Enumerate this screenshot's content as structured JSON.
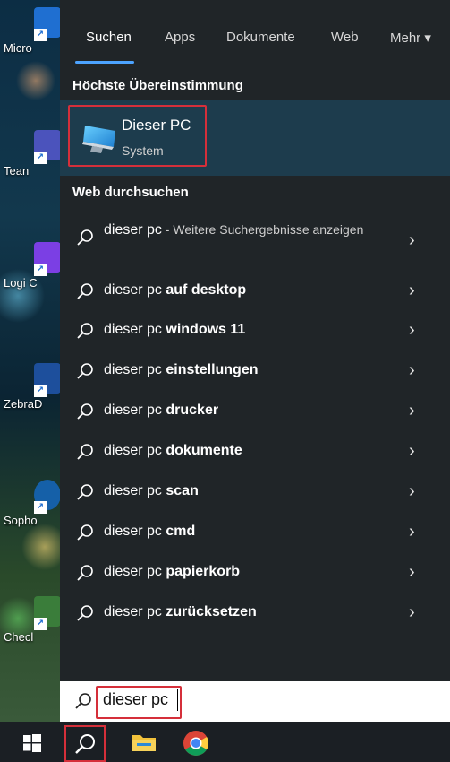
{
  "desktop": {
    "icons": [
      {
        "label": "Micro"
      },
      {
        "label": "Tean"
      },
      {
        "label": "Logi C"
      },
      {
        "label": "ZebraD"
      },
      {
        "label": "Sopho"
      },
      {
        "label": "Checl"
      }
    ]
  },
  "tabs": {
    "items": [
      {
        "label": "Suchen",
        "active": true
      },
      {
        "label": "Apps"
      },
      {
        "label": "Dokumente"
      },
      {
        "label": "Web"
      },
      {
        "label": "Mehr ▾"
      }
    ]
  },
  "best_match": {
    "heading": "Höchste Übereinstimmung",
    "title": "Dieser PC",
    "subtitle": "System"
  },
  "web": {
    "heading": "Web durchsuchen",
    "first": {
      "query": "dieser pc",
      "suffix": " - Weitere Suchergebnisse anzeigen"
    },
    "suggestions": [
      {
        "prefix": "dieser pc ",
        "bold": "auf desktop"
      },
      {
        "prefix": "dieser pc ",
        "bold": "windows 11"
      },
      {
        "prefix": "dieser pc ",
        "bold": "einstellungen"
      },
      {
        "prefix": "dieser pc ",
        "bold": "drucker"
      },
      {
        "prefix": "dieser pc ",
        "bold": "dokumente"
      },
      {
        "prefix": "dieser pc ",
        "bold": "scan"
      },
      {
        "prefix": "dieser pc ",
        "bold": "cmd"
      },
      {
        "prefix": "dieser pc ",
        "bold": "papierkorb"
      },
      {
        "prefix": "dieser pc ",
        "bold": "zurücksetzen"
      }
    ]
  },
  "search": {
    "value": "dieser pc"
  },
  "colors": {
    "panel": "#202528",
    "highlight": "#1d3c4d",
    "accent": "#4ca3ff",
    "annotation": "#d52f3a"
  },
  "icons": [
    "search-icon",
    "chevron-right-icon",
    "computer-icon",
    "windows-icon",
    "folder-icon",
    "chrome-icon"
  ]
}
